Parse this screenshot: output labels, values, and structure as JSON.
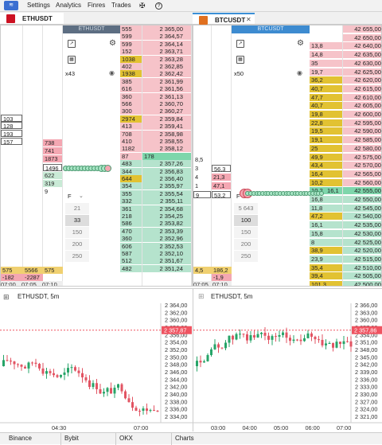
{
  "menu": {
    "settings": "Settings",
    "analytics": "Analytics",
    "finres": "Finres",
    "trades": "Trades"
  },
  "colors": {
    "ask": "#f6c3c9",
    "bid": "#b5e3cd",
    "big_ask": "#e2c232",
    "mid_line": "#7ed6ab",
    "accent_blue": "#3b8fd6",
    "bull": "#27a468",
    "bear": "#e25463",
    "price_marker": "#ef5461"
  },
  "panels": [
    {
      "tab": "ETHUSDT",
      "tab_color": "#cc1122",
      "header": "ETHUSDT",
      "multiplier": "x43",
      "scales": [
        "21",
        "33",
        "150",
        "200",
        "250"
      ],
      "scale_selected": "33",
      "scale_head": "F",
      "ask_sizes": [
        "555",
        "599",
        "599",
        "152",
        "1038",
        "402",
        "1938",
        "385",
        "616",
        "360",
        "566",
        "300",
        "2974",
        "413",
        "708",
        "410",
        "1182",
        "87"
      ],
      "ask_prices": [
        "2 365,00",
        "2 364,57",
        "2 364,14",
        "2 363,71",
        "2 363,28",
        "2 362,85",
        "2 362,42",
        "2 361,99",
        "2 361,56",
        "2 361,13",
        "2 360,70",
        "2 360,27",
        "2 359,84",
        "2 359,41",
        "2 358,98",
        "2 358,55",
        "2 358,12",
        "2 357,69"
      ],
      "bid_sizes": [
        "483",
        "344",
        "644",
        "354",
        "355",
        "332",
        "361",
        "218",
        "586",
        "470",
        "360",
        "606",
        "587",
        "512",
        "482"
      ],
      "bid_prices": [
        "2 357,26",
        "2 356,83",
        "2 356,40",
        "2 355,97",
        "2 355,54",
        "2 355,11",
        "2 354,68",
        "2 354,25",
        "2 353,82",
        "2 353,39",
        "2 352,96",
        "2 352,53",
        "2 352,10",
        "2 351,67",
        "2 351,24"
      ],
      "mid_size": "178",
      "mid_price": "2 357,69",
      "cluster_col1": [
        "103",
        "128",
        "193",
        "157",
        "",
        "1496",
        "622",
        "319",
        "9"
      ],
      "cluster_col2": [
        "738",
        "741",
        "1873",
        "1496"
      ],
      "footer_vals": [
        "575",
        "5566",
        "-182",
        "-2287"
      ],
      "footer_times": [
        "07:00",
        "07:05",
        "07:10"
      ],
      "trade_bubbles": "1696 1362 1456 1211 1346 270"
    },
    {
      "tab": "BTCUSDT",
      "tab_color": "#e07020",
      "header": "BTCUSDT",
      "multiplier": "x50",
      "scales": [
        "5 643",
        "100",
        "150",
        "200",
        "250"
      ],
      "scale_selected": "100",
      "scale_head": "F",
      "ask_sizes": [
        "",
        "",
        "13,8",
        "14,8",
        "35",
        "19,7",
        "36,2",
        "40,7",
        "47,7",
        "40,7",
        "19,8",
        "22,8",
        "19,5",
        "19,1",
        "25",
        "49,9",
        "43,4",
        "16,4",
        "10,2"
      ],
      "ask_prices": [
        "42 655,00",
        "42 650,00",
        "42 640,00",
        "42 635,00",
        "42 630,00",
        "42 625,00",
        "42 620,00",
        "42 615,00",
        "42 610,00",
        "42 605,00",
        "42 600,00",
        "42 595,00",
        "42 590,00",
        "42 585,00",
        "42 580,00",
        "42 575,00",
        "42 570,00",
        "42 565,00",
        "42 560,00"
      ],
      "bid_sizes": [
        "16,8",
        "11,8",
        "47,2",
        "16,1",
        "15,8",
        "8",
        "38,9",
        "23,9",
        "35,4",
        "39,4",
        "101,3"
      ],
      "bid_prices": [
        "42 550,00",
        "42 545,00",
        "42 540,00",
        "42 535,00",
        "42 530,00",
        "42 525,00",
        "42 520,00",
        "42 515,00",
        "42 510,00",
        "42 505,00",
        "42 500,00"
      ],
      "mid_size": "16,1",
      "mid_price": "42 555,00",
      "cluster_col1": [
        "8,5",
        "3",
        "4",
        "1",
        "9",
        "56,3",
        "21,3",
        "47,1",
        "53,2"
      ],
      "footer_vals": [
        "4,5",
        "186,2",
        "-1,9"
      ],
      "footer_times": [
        "07:05",
        "07:10"
      ]
    }
  ],
  "charts": [
    {
      "title": "ETHUSDT, 5m",
      "exchange_tab": "Binance",
      "price_tag": "2 357,87",
      "y_labels": [
        "2 364,00",
        "2 362,00",
        "2 360,00",
        "2 358,00",
        "2 356,00",
        "2 354,00",
        "2 352,00",
        "2 350,00",
        "2 348,00",
        "2 346,00",
        "2 344,00",
        "2 342,00",
        "2 340,00",
        "2 338,00",
        "2 336,00",
        "2 334,00"
      ],
      "x_labels": [
        "04:30",
        "07:00"
      ]
    },
    {
      "title": "ETHUSDT, 5m",
      "exchange_tab": "Bybit",
      "price_tag": "2 357,86",
      "y_labels": [
        "2 366,00",
        "2 363,00",
        "2 360,00",
        "2 357,00",
        "2 354,00",
        "2 351,00",
        "2 348,00",
        "2 345,00",
        "2 342,00",
        "2 339,00",
        "2 336,00",
        "2 333,00",
        "2 330,00",
        "2 327,00",
        "2 324,00",
        "2 321,00"
      ],
      "x_labels": [
        "03:00",
        "04:00",
        "05:00",
        "06:00",
        "07:00"
      ]
    }
  ],
  "bottom_tabs": [
    "Binance",
    "Bybit",
    "OKX",
    "Charts"
  ]
}
